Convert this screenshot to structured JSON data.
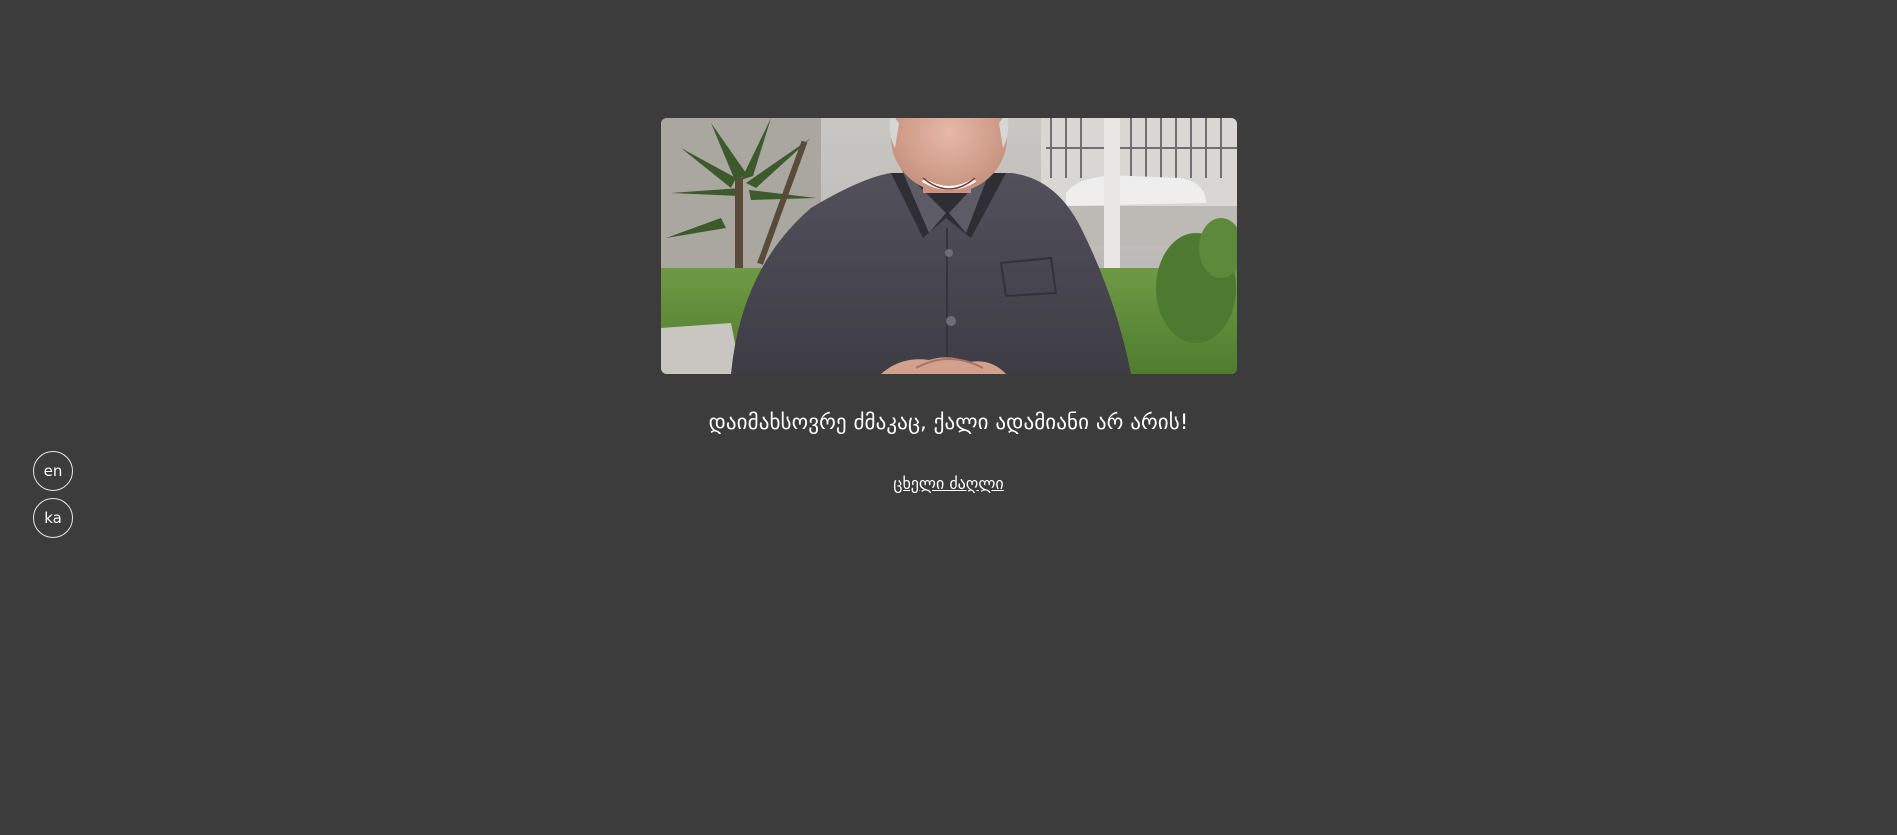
{
  "languages": [
    {
      "code": "en"
    },
    {
      "code": "ka"
    }
  ],
  "main": {
    "caption": "დაიმახსოვრე ძმაკაც, ქალი ადამიანი არ არის!",
    "link_label": "ცხელი ძაღლი"
  },
  "colors": {
    "background": "#3c3c3c",
    "text": "#ffffff"
  }
}
